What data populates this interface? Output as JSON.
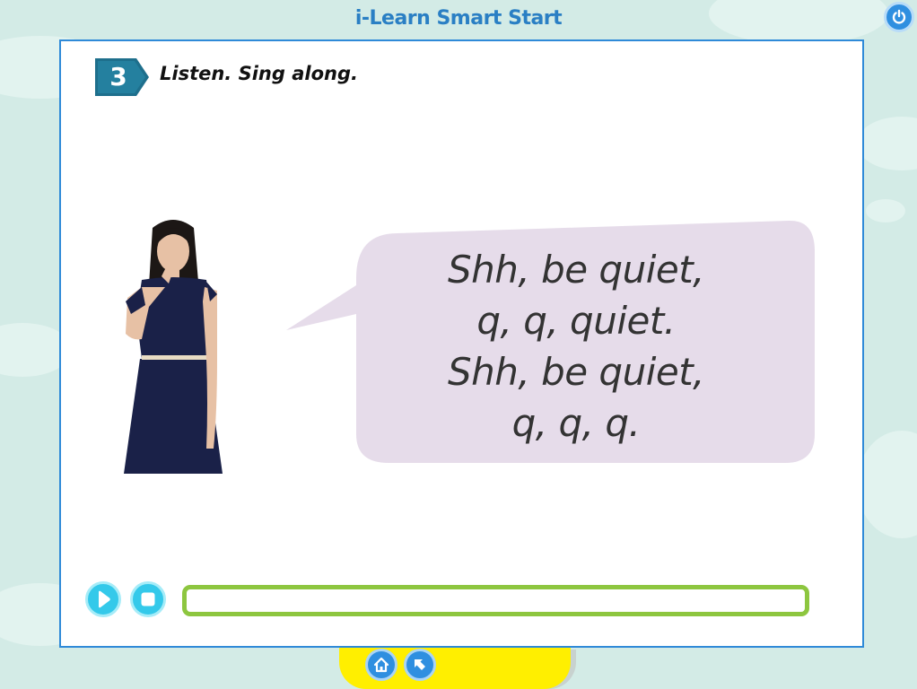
{
  "app": {
    "title": "i-Learn Smart Start"
  },
  "controls": {
    "power_icon": "power-icon"
  },
  "activity": {
    "number": "3",
    "instruction": "Listen. Sing along.",
    "lyrics": [
      "Shh, be quiet,",
      "q, q, quiet.",
      "Shh, be quiet,",
      "q, q, q."
    ]
  },
  "player": {
    "play_icon": "play-icon",
    "stop_icon": "stop-icon",
    "progress": 0
  },
  "nav": {
    "home_icon": "home-icon",
    "back_icon": "back-arrow-icon"
  },
  "colors": {
    "accent": "#2f8fe0",
    "progress": "#8dc63f",
    "bubble": "#e6dcea",
    "badge": "#1e6f8c",
    "nav_bar": "#ffef00",
    "player_button": "#34c9ea"
  }
}
